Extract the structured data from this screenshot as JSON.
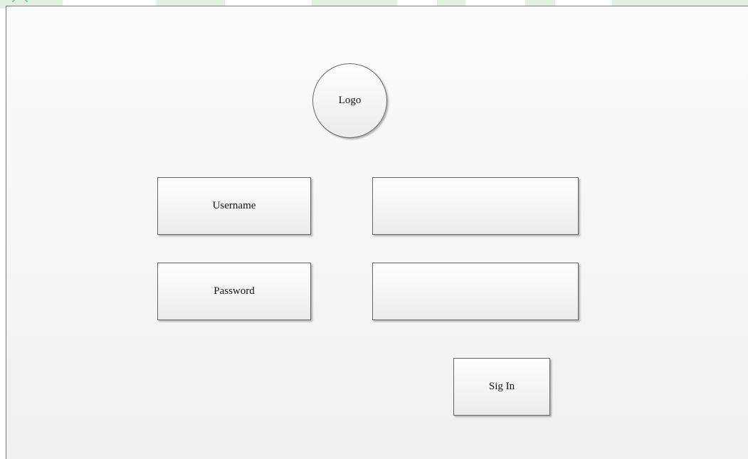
{
  "login_mockup": {
    "logo_text": "Logo",
    "username_label": "Username",
    "password_label": "Password",
    "username_value": "",
    "password_value": "",
    "signin_label": "Sig In"
  },
  "colors": {
    "canvas_background": "#ffffff",
    "frame_background": "#f4f4f4",
    "shape_border": "#666666",
    "text": "#111111",
    "watermark_green": "#d6ead6"
  }
}
